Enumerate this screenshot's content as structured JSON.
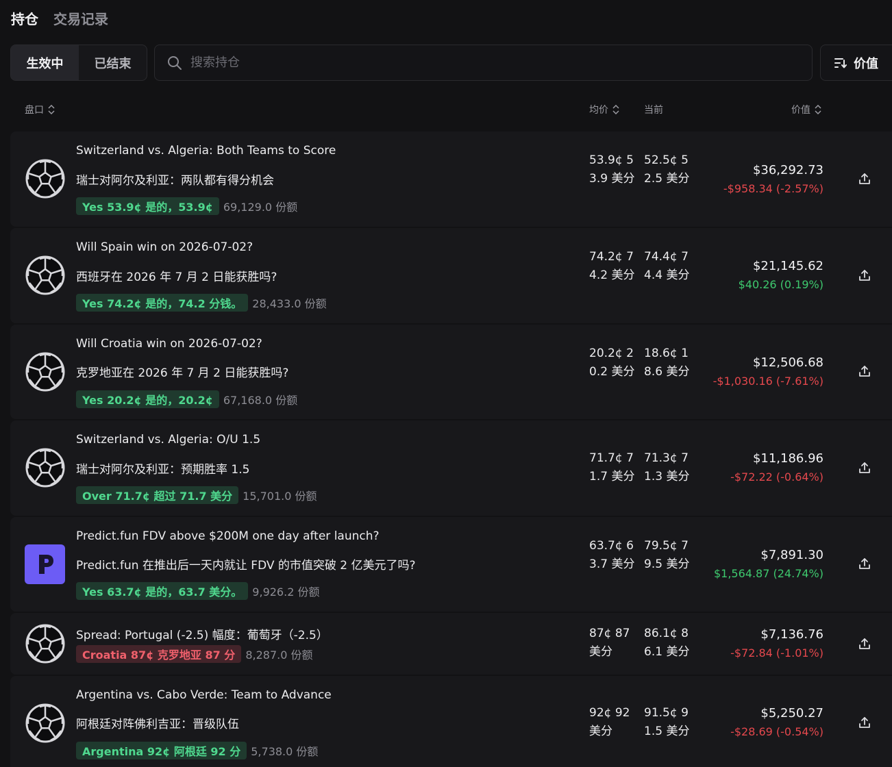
{
  "tabs": [
    {
      "label": "持仓",
      "active": true
    },
    {
      "label": "交易记录",
      "active": false
    }
  ],
  "filter": {
    "active_label": "生效中",
    "ended_label": "已结束"
  },
  "search": {
    "placeholder": "搜索持仓"
  },
  "sort": {
    "label": "价值"
  },
  "columns": {
    "market": "盘口",
    "avg": "均价",
    "current": "当前",
    "value": "价值"
  },
  "colors": {
    "green": "#3ec96e",
    "red": "#e5484d",
    "predict_logo": "#6c5cf5"
  },
  "positions": [
    {
      "icon": "soccer-ball-icon",
      "title": "Switzerland vs. Algeria: Both Teams to Score",
      "subtitle": "瑞士对阿尔及利亚：两队都有得分机会",
      "outcome": "Yes 53.9¢  是的，53.9¢",
      "outcome_color": "green",
      "shares": "69,129.0 份额",
      "avg": "53.9¢ 53.9 美分",
      "current": "52.5¢ 52.5 美分",
      "value": "$36,292.73",
      "change": "-$958.34 (-2.57%)",
      "change_sign": "neg"
    },
    {
      "icon": "soccer-ball-icon",
      "title": "Will Spain win on 2026-07-02?",
      "subtitle": "西班牙在 2026 年 7 月 2 日能获胜吗?",
      "outcome": "Yes 74.2¢  是的，74.2 分钱。",
      "outcome_color": "green",
      "shares": "28,433.0 份额",
      "avg": "74.2¢ 74.2 美分",
      "current": "74.4¢ 74.4 美分",
      "value": "$21,145.62",
      "change": "$40.26 (0.19%)",
      "change_sign": "pos"
    },
    {
      "icon": "soccer-ball-icon",
      "title": "Will Croatia win on 2026-07-02?",
      "subtitle": "克罗地亚在 2026 年 7 月 2 日能获胜吗?",
      "outcome": "Yes 20.2¢  是的，20.2¢",
      "outcome_color": "green",
      "shares": "67,168.0 份额",
      "avg": "20.2¢ 20.2 美分",
      "current": "18.6¢ 18.6 美分",
      "value": "$12,506.68",
      "change": "-$1,030.16 (-7.61%)",
      "change_sign": "neg"
    },
    {
      "icon": "soccer-ball-icon",
      "title": "Switzerland vs. Algeria: O/U 1.5",
      "subtitle": "瑞士对阿尔及利亚：预期胜率 1.5",
      "outcome": "Over 71.7¢  超过 71.7 美分",
      "outcome_color": "green",
      "shares": "15,701.0 份额",
      "avg": "71.7¢ 71.7 美分",
      "current": "71.3¢ 71.3 美分",
      "value": "$11,186.96",
      "change": "-$72.22 (-0.64%)",
      "change_sign": "neg"
    },
    {
      "icon": "predict-fun-logo-icon",
      "title": "Predict.fun FDV above $200M one day after launch?",
      "subtitle": "Predict.fun 在推出后一天内就让 FDV 的市值突破 2 亿美元了吗?",
      "outcome": "Yes 63.7¢  是的，63.7 美分。",
      "outcome_color": "green",
      "shares": "9,926.2 份额",
      "avg": "63.7¢ 63.7 美分",
      "current": "79.5¢ 79.5 美分",
      "value": "$7,891.30",
      "change": "$1,564.87 (24.74%)",
      "change_sign": "pos"
    },
    {
      "icon": "soccer-ball-icon",
      "title": "Spread: Portugal (-2.5)  幅度：葡萄牙（-2.5）",
      "subtitle": "",
      "outcome": "Croatia 87¢  克罗地亚 87 分",
      "outcome_color": "red",
      "shares": "8,287.0 份额",
      "avg": "87¢ 87 美分",
      "current": "86.1¢ 86.1 美分",
      "value": "$7,136.76",
      "change": "-$72.84 (-1.01%)",
      "change_sign": "neg"
    },
    {
      "icon": "soccer-ball-icon",
      "title": "Argentina vs. Cabo Verde: Team to Advance",
      "subtitle": "阿根廷对阵佛利吉亚：晋级队伍",
      "outcome": "Argentina 92¢  阿根廷 92 分",
      "outcome_color": "green",
      "shares": "5,738.0 份额",
      "avg": "92¢ 92 美分",
      "current": "91.5¢ 91.5 美分",
      "value": "$5,250.27",
      "change": "-$28.69 (-0.54%)",
      "change_sign": "neg"
    }
  ]
}
